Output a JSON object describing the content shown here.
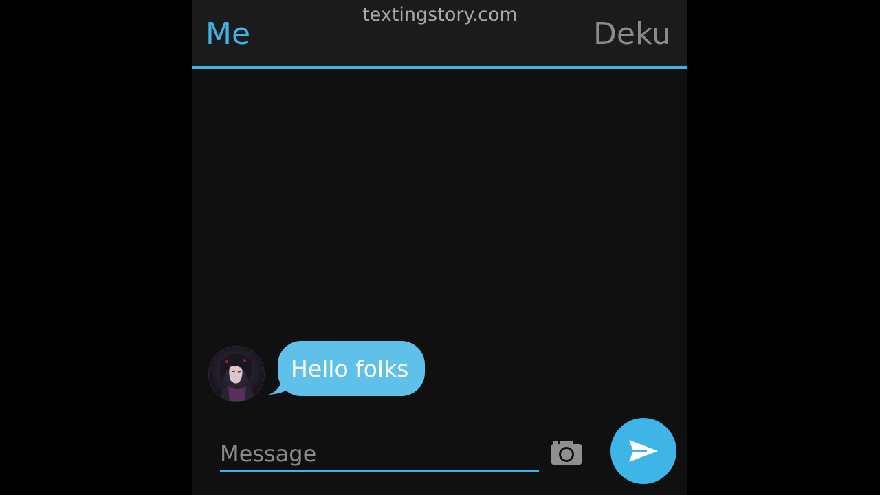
{
  "watermark": "textingstory.com",
  "header": {
    "sender_label": "Me",
    "contact_label": "Deku"
  },
  "messages": [
    {
      "text": "Hello folks",
      "from": "Deku",
      "has_avatar": true
    }
  ],
  "composer": {
    "placeholder": "Message",
    "value": ""
  },
  "icons": {
    "camera": "camera-icon",
    "send": "send-icon"
  },
  "colors": {
    "accent": "#3fb4e6",
    "bubble": "#5fc0ea",
    "background": "#101010",
    "header_background": "#1b1b1b"
  }
}
